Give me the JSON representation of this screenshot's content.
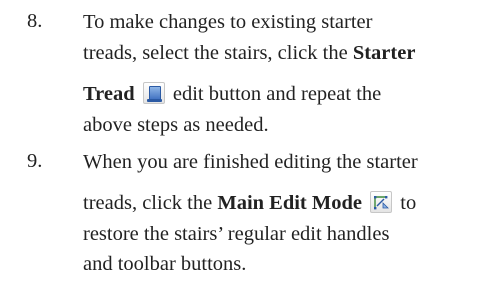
{
  "steps": [
    {
      "number": "8.",
      "lines": [
        "To make changes to existing starter",
        "treads, select the stairs, click the",
        "Starter",
        "Tread",
        "edit button and repeat the",
        "above steps as needed."
      ],
      "icon": "starter-tread-icon"
    },
    {
      "number": "9.",
      "lines": [
        "When you are finished editing the starter",
        "treads, click the",
        "Main Edit Mode",
        "to",
        "restore the stairs’ regular edit handles",
        "and toolbar buttons."
      ],
      "icon": "main-edit-mode-icon"
    }
  ]
}
